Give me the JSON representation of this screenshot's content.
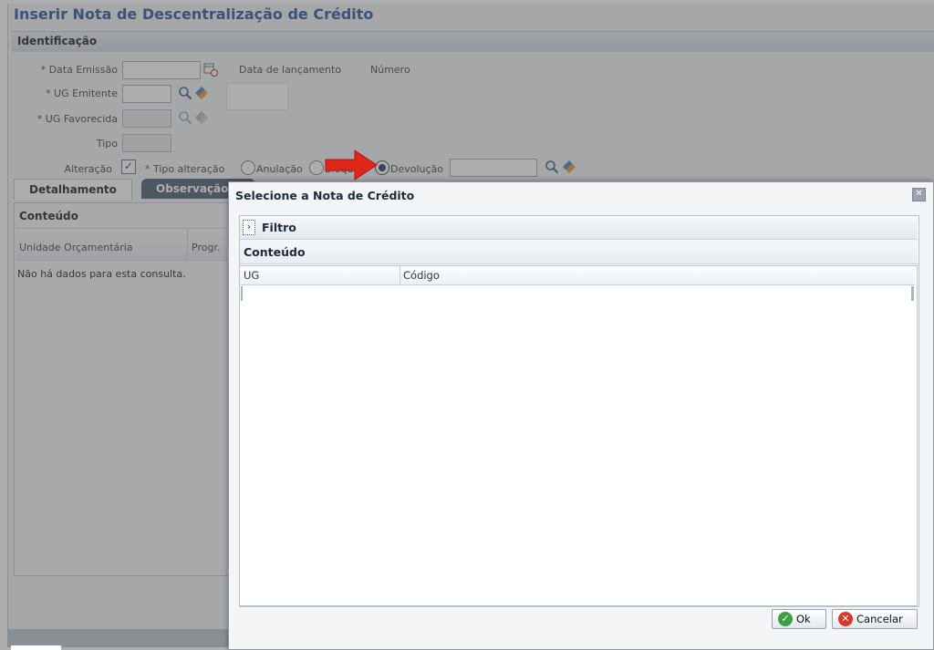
{
  "page": {
    "title": "Inserir Nota de Descentralização de Crédito"
  },
  "identificacao": {
    "section_title": "Identificação",
    "data_emissao_label": "* Data Emissão",
    "data_lancamento_label": "Data de lançamento",
    "numero_label": "Número",
    "ug_emitente_label": "* UG Emitente",
    "ug_favorecida_label": "* UG Favorecida",
    "tipo_label": "Tipo",
    "alteracao_label": "Alteração",
    "alteracao_checked": true,
    "tipo_alteracao_label": "* Tipo alteração",
    "tipo_alteracao_options": [
      "Anulação",
      "Bloqueio",
      "Devolução"
    ],
    "tipo_alteracao_selected": "Devolução"
  },
  "tabs": [
    {
      "label": "Detalhamento",
      "active": true
    },
    {
      "label": "Observação",
      "active": false
    }
  ],
  "conteudo": {
    "title": "Conteúdo",
    "columns": [
      "Unidade Orçamentária",
      "Progr."
    ],
    "empty_message": "Não há dados para esta consulta."
  },
  "dialog": {
    "title": "Selecione a Nota de Crédito",
    "filtro_label": "Filtro",
    "conteudo_label": "Conteúdo",
    "columns": [
      "UG",
      "Código"
    ],
    "ok_label": "Ok",
    "cancel_label": "Cancelar"
  },
  "colors": {
    "title_blue": "#3a64a0",
    "arrow_red": "#e0251b",
    "ok_green": "#3aa040",
    "cancel_red": "#d9352b"
  }
}
